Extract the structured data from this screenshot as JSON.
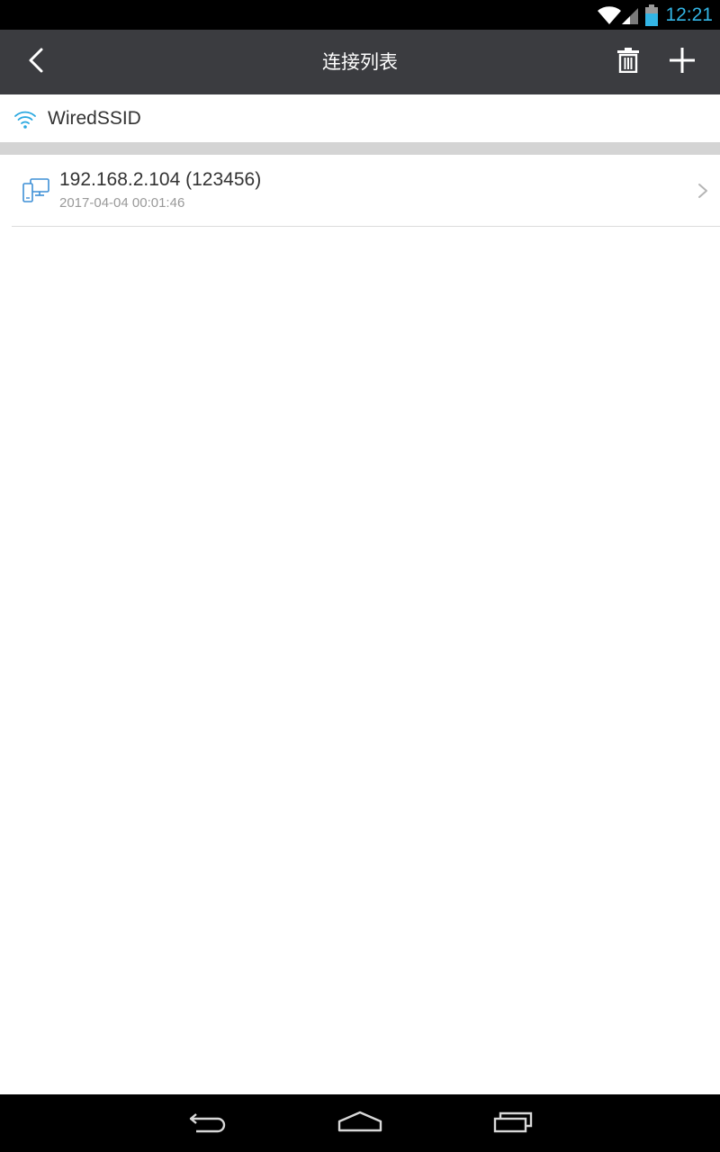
{
  "status_bar": {
    "time": "12:21",
    "icons": [
      "wifi-signal-icon",
      "cell-signal-icon",
      "battery-icon"
    ],
    "clock_color": "#33b5e5"
  },
  "app_bar": {
    "title": "连接列表",
    "icons": [
      "back-arrow-icon",
      "trash-icon",
      "plus-icon"
    ],
    "background": "#3b3c40"
  },
  "network": {
    "ssid": "WiredSSID",
    "icon": "wifi-icon",
    "accent": "#2aa8e0"
  },
  "connections": [
    {
      "address": "192.168.2.104 (123456)",
      "timestamp": "2017-04-04 00:01:46",
      "icon": "devices-icon"
    }
  ],
  "nav_bar": {
    "buttons": [
      "back-icon",
      "home-icon",
      "recents-icon"
    ]
  }
}
